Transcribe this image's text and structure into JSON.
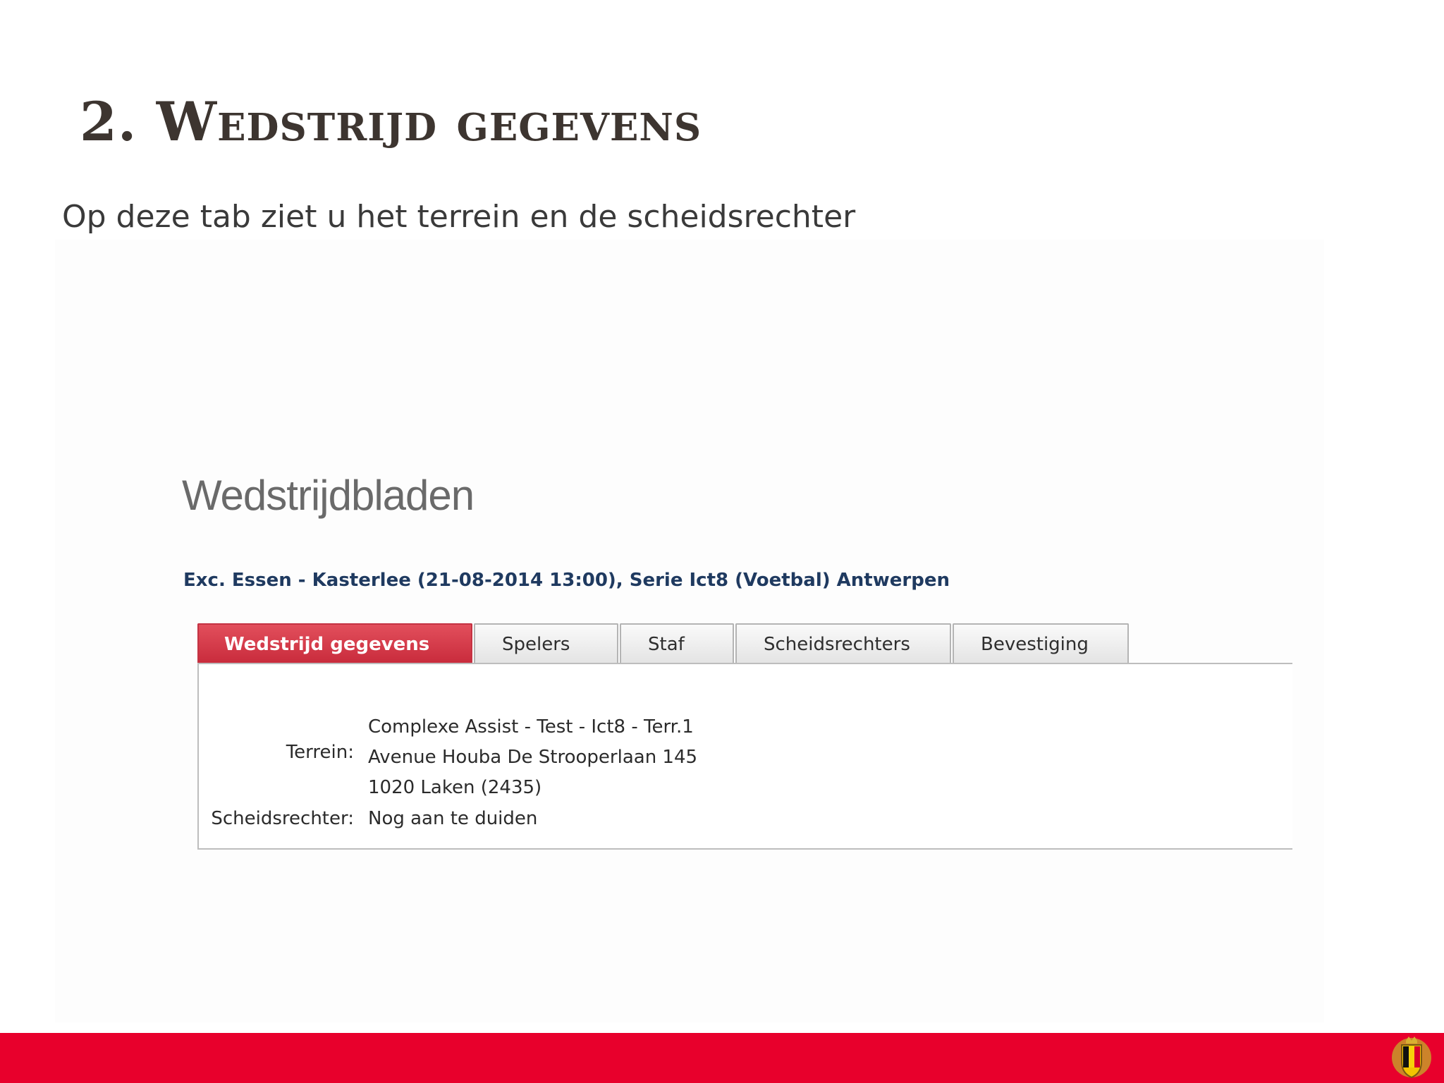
{
  "slide": {
    "title": "2. Wedstrijd gegevens",
    "subtitle": "Op deze tab ziet u het terrein en de scheidsrechter"
  },
  "app": {
    "heading": "Wedstrijdbladen",
    "match": "Exc. Essen - Kasterlee (21-08-2014 13:00), Serie Ict8 (Voetbal) Antwerpen",
    "tabs": [
      {
        "label": "Wedstrijd gegevens",
        "active": true
      },
      {
        "label": "Spelers",
        "active": false
      },
      {
        "label": "Staf",
        "active": false
      },
      {
        "label": "Scheidsrechters",
        "active": false
      },
      {
        "label": "Bevestiging",
        "active": false
      }
    ],
    "details": {
      "terrain_label": "Terrein:",
      "terrain_line1": "Complexe Assist - Test - Ict8 - Terr.1",
      "terrain_line2": "Avenue Houba De Strooperlaan 145",
      "terrain_line3": "1020 Laken (2435)",
      "referee_label": "Scheidsrechter:",
      "referee_value": "Nog aan te duiden"
    }
  },
  "colors": {
    "accent": "#e8002c",
    "tab_active": "#c82a3b",
    "match_text": "#1f3a60"
  },
  "footer": {
    "crest_icon": "belgian-crest-icon"
  }
}
